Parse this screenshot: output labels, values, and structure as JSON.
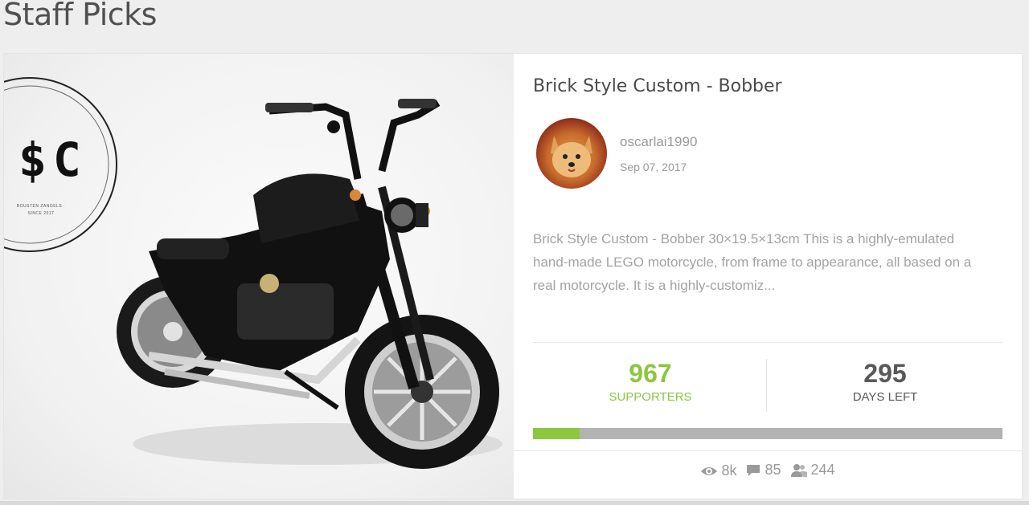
{
  "section": {
    "title": "Staff Picks"
  },
  "project": {
    "title": "Brick Style Custom - Bobber",
    "logo_text": "$C",
    "logo_small_text": "BOUSTEN ZANGELS · SINCE 2017",
    "author": "oscarlai1990",
    "date": "Sep 07, 2017",
    "description": "Brick Style Custom - Bobber 30×19.5×13cm This is a highly-emulated hand-made LEGO motorcycle, from frame to appearance, all based on a real motorcycle. It is a highly-customiz...",
    "supporters_value": "967",
    "supporters_label": "SUPPORTERS",
    "days_value": "295",
    "days_label": "DAYS LEFT",
    "progress_fraction": 0.1,
    "views": "8k",
    "comments": "85",
    "followers": "244"
  },
  "icons": {
    "views": "eye-icon",
    "comments": "comment-icon",
    "followers": "users-icon"
  },
  "colors": {
    "accent": "#8dc63f",
    "progress_track": "#b3b3b3",
    "text_muted": "#9a9a9a"
  }
}
